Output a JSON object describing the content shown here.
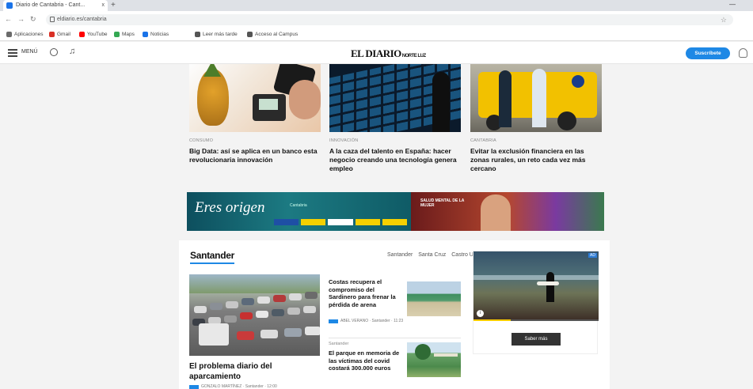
{
  "browser": {
    "tab_title": "Diario de Cantabria - Cant...",
    "tab_close": "x",
    "new_tab": "+",
    "url": "eldiario.es/cantabria",
    "window_control": "—",
    "bookmarks": [
      {
        "label": "Aplicaciones",
        "color": "#6b6b6b"
      },
      {
        "label": "Gmail",
        "color": "#d93025"
      },
      {
        "label": "YouTube",
        "color": "#ff0000"
      },
      {
        "label": "Maps",
        "color": "#34a853"
      },
      {
        "label": "Noticias",
        "color": "#1a73e8"
      },
      {
        "label": "Leer más tarde",
        "color": "#555555"
      },
      {
        "label": "Acceso al Campus",
        "color": "#555555"
      }
    ]
  },
  "header": {
    "menu_label": "MENÚ",
    "logo_main": "EL DIARIO",
    "logo_sub": "NORTE LUZ",
    "subscribe_label": "Suscríbete",
    "accent_color": "#1e88e5"
  },
  "top_articles": [
    {
      "category": "CONSUMO",
      "title": "Big Data: así se aplica en un banco esta revolucionaria innovación"
    },
    {
      "category": "INNOVACIÓN",
      "title": "A la caza del talento en España: hacer negocio creando una tecnología genera empleo"
    },
    {
      "category": "CANTABRIA",
      "title": "Evitar la exclusión financiera en las zonas rurales, un reto cada vez más cercano"
    }
  ],
  "ads": {
    "banner1_headline": "Eres origen",
    "banner1_small": "Cantabria",
    "banner2_text": "SALUD MENTAL DE LA MUJER"
  },
  "santander": {
    "title": "Santander",
    "links": [
      "Santander",
      "Santa Cruz",
      "Castro Urdiales"
    ],
    "main_story": {
      "title": "El problema diario del aparcamiento",
      "byline": "GONZALO MARTÍNEZ · Santander · 12:00"
    },
    "side_stories": [
      {
        "category": "",
        "title": "Costas recupera el compromiso del Sardinero para frenar la pérdida de arena",
        "byline": "ABEL VERANO · Santander · 11:23"
      },
      {
        "category": "Santander",
        "title": "El parque en memoria de las víctimas del covid costará 300.000 euros",
        "byline": ""
      }
    ],
    "video": {
      "ad_label": "AD",
      "info": "i",
      "button_label": "Saber más",
      "progress": 0.3
    }
  }
}
